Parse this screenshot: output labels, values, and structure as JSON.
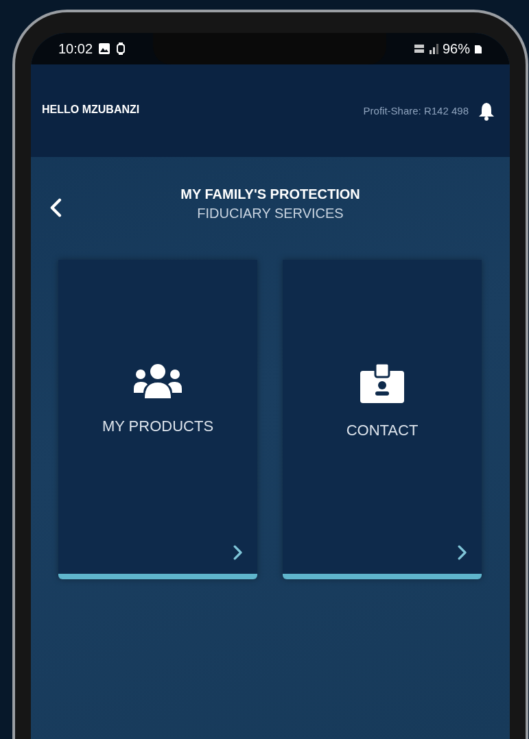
{
  "status_bar": {
    "time": "10:02",
    "battery": "96%"
  },
  "header": {
    "greeting": "HELLO MZUBANZI",
    "profit_share": "Profit-Share: R142 498"
  },
  "page": {
    "title": "MY FAMILY'S PROTECTION",
    "subtitle": "FIDUCIARY SERVICES"
  },
  "cards": [
    {
      "label": "MY PRODUCTS"
    },
    {
      "label": "CONTACT"
    }
  ]
}
